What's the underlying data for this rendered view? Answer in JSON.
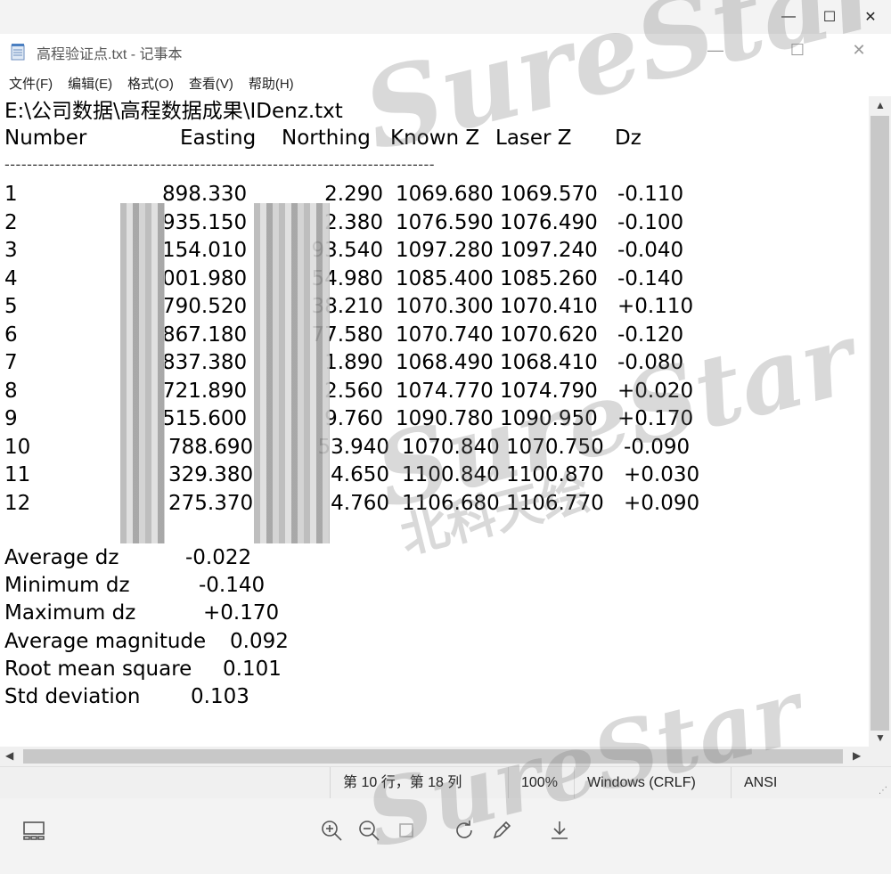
{
  "viewer": {
    "minimize": "—",
    "maximize": "☐",
    "close": "✕"
  },
  "notepad": {
    "title": "高程验证点.txt - 记事本",
    "min": "—",
    "max": "☐",
    "close": "✕",
    "menu": [
      "文件(F)",
      "编辑(E)",
      "格式(O)",
      "查看(V)",
      "帮助(H)"
    ]
  },
  "document": {
    "path": "E:\\公司数据\\高程数据成果\\IDenz.txt",
    "headers": [
      "Number",
      "Easting",
      "Northing",
      "Known Z",
      "Laser Z",
      "Dz"
    ],
    "separator": "-----------------------------------------------------------------------------",
    "rows": [
      {
        "n": "1",
        "e": "898.330",
        "nt": "2.290",
        "kz": "1069.680",
        "lz": "1069.570",
        "dz": "-0.110"
      },
      {
        "n": "2",
        "e": "935.150",
        "nt": "2.380",
        "kz": "1076.590",
        "lz": "1076.490",
        "dz": "-0.100"
      },
      {
        "n": "3",
        "e": "154.010",
        "nt": "93.540",
        "kz": "1097.280",
        "lz": "1097.240",
        "dz": "-0.040"
      },
      {
        "n": "4",
        "e": "001.980",
        "nt": "54.980",
        "kz": "1085.400",
        "lz": "1085.260",
        "dz": "-0.140"
      },
      {
        "n": "5",
        "e": "790.520",
        "nt": "38.210",
        "kz": "1070.300",
        "lz": "1070.410",
        "dz": "+0.110"
      },
      {
        "n": "6",
        "e": "867.180",
        "nt": "77.580",
        "kz": "1070.740",
        "lz": "1070.620",
        "dz": "-0.120"
      },
      {
        "n": "7",
        "e": "837.380",
        "nt": "1.890",
        "kz": "1068.490",
        "lz": "1068.410",
        "dz": "-0.080"
      },
      {
        "n": "8",
        "e": "721.890",
        "nt": "2.560",
        "kz": "1074.770",
        "lz": "1074.790",
        "dz": "+0.020"
      },
      {
        "n": "9",
        "e": "515.600",
        "nt": "9.760",
        "kz": "1090.780",
        "lz": "1090.950",
        "dz": "+0.170"
      },
      {
        "n": "10",
        "e": "788.690",
        "nt": "53.940",
        "kz": "1070.840",
        "lz": "1070.750",
        "dz": "-0.090"
      },
      {
        "n": "11",
        "e": "329.380",
        "nt": "4.650",
        "kz": "1100.840",
        "lz": "1100.870",
        "dz": "+0.030"
      },
      {
        "n": "12",
        "e": "275.370",
        "nt": "4.760",
        "kz": "1106.680",
        "lz": "1106.770",
        "dz": "+0.090"
      }
    ],
    "stats": [
      {
        "label": "Average dz",
        "value": "-0.022"
      },
      {
        "label": "Minimum dz",
        "value": "-0.140"
      },
      {
        "label": "Maximum dz",
        "value": "+0.170"
      },
      {
        "label": "Average magnitude",
        "value": "0.092"
      },
      {
        "label": "Root mean square",
        "value": "0.101"
      },
      {
        "label": "Std deviation",
        "value": "0.103"
      }
    ]
  },
  "status": {
    "position": "第 10 行，第 18 列",
    "zoom": "100%",
    "eol": "Windows (CRLF)",
    "encoding": "ANSI"
  },
  "watermark": {
    "text": "SureStar",
    "cn": "北科天绘"
  },
  "icons": [
    "gallery-icon",
    "zoom-in-icon",
    "zoom-out-icon",
    "crop-icon",
    "rotate-icon",
    "edit-icon",
    "download-icon"
  ]
}
